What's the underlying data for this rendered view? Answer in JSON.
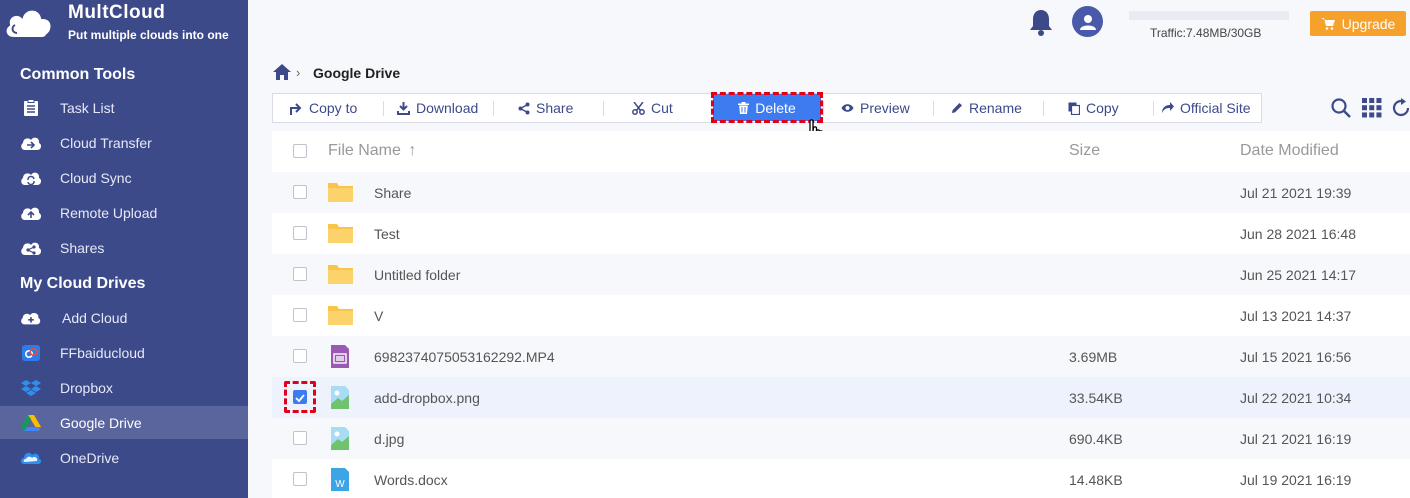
{
  "brand": {
    "name": "MultCloud",
    "tagline": "Put multiple clouds into one"
  },
  "sidebar": {
    "common_tools_title": "Common Tools",
    "common_tools": [
      {
        "label": "Task List",
        "icon": "task-list-icon"
      },
      {
        "label": "Cloud Transfer",
        "icon": "cloud-transfer-icon"
      },
      {
        "label": "Cloud Sync",
        "icon": "cloud-sync-icon"
      },
      {
        "label": "Remote Upload",
        "icon": "remote-upload-icon"
      },
      {
        "label": "Shares",
        "icon": "share-icon"
      }
    ],
    "my_drives_title": "My Cloud Drives",
    "my_drives": [
      {
        "label": "Add Cloud",
        "icon": "add-cloud-icon"
      },
      {
        "label": "FFbaiducloud",
        "icon": "baidu-icon"
      },
      {
        "label": "Dropbox",
        "icon": "dropbox-icon"
      },
      {
        "label": "Google Drive",
        "icon": "google-drive-icon",
        "active": true
      },
      {
        "label": "OneDrive",
        "icon": "onedrive-icon"
      }
    ]
  },
  "header": {
    "traffic": "Traffic:7.48MB/30GB",
    "traffic_used_fraction": 0.0002,
    "upgrade_label": "Upgrade"
  },
  "breadcrumb": {
    "current": "Google Drive"
  },
  "toolbar": {
    "buttons": [
      {
        "label": "Copy to",
        "icon": "copy-to-icon"
      },
      {
        "label": "Download",
        "icon": "download-icon"
      },
      {
        "label": "Share",
        "icon": "share-icon"
      },
      {
        "label": "Cut",
        "icon": "scissors-icon"
      },
      {
        "label": "Delete",
        "icon": "trash-icon",
        "highlighted": true
      },
      {
        "label": "Preview",
        "icon": "eye-icon"
      },
      {
        "label": "Rename",
        "icon": "pencil-icon"
      },
      {
        "label": "Copy",
        "icon": "copy-icon"
      },
      {
        "label": "Official Site",
        "icon": "external-link-icon"
      }
    ]
  },
  "table": {
    "headers": {
      "name": "File Name",
      "size": "Size",
      "date": "Date Modified"
    },
    "rows": [
      {
        "name": "Share",
        "type": "folder",
        "size": "",
        "date": "Jul 21 2021 19:39",
        "checked": false
      },
      {
        "name": "Test",
        "type": "folder",
        "size": "",
        "date": "Jun 28 2021 16:48",
        "checked": false
      },
      {
        "name": "Untitled folder",
        "type": "folder",
        "size": "",
        "date": "Jun 25 2021 14:17",
        "checked": false
      },
      {
        "name": "V",
        "type": "folder",
        "size": "",
        "date": "Jul 13 2021 14:37",
        "checked": false
      },
      {
        "name": "6982374075053162292.MP4",
        "type": "video",
        "size": "3.69MB",
        "date": "Jul 15 2021 16:56",
        "checked": false
      },
      {
        "name": "add-dropbox.png",
        "type": "image",
        "size": "33.54KB",
        "date": "Jul 22 2021 10:34",
        "checked": true
      },
      {
        "name": "d.jpg",
        "type": "image",
        "size": "690.4KB",
        "date": "Jul 21 2021 16:19",
        "checked": false
      },
      {
        "name": "Words.docx",
        "type": "doc",
        "size": "14.48KB",
        "date": "Jul 19 2021 16:19",
        "checked": false
      }
    ]
  },
  "colors": {
    "sidebar_bg": "#3d4a8a",
    "accent": "#3d7bf0",
    "upgrade": "#f6a12b",
    "highlight": "#e0001a"
  }
}
